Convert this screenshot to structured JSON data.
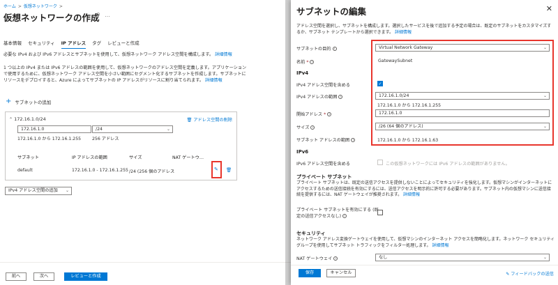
{
  "breadcrumb": {
    "home": "ホーム",
    "vnet": "仮想ネットワーク"
  },
  "page_title": "仮想ネットワークの作成",
  "tabs": [
    "基本情報",
    "セキュリティ",
    "IP アドレス",
    "タグ",
    "レビューと作成"
  ],
  "intro": {
    "line1": "必要な IPv4 および IPv6 アドレスとサブネットを使用して、仮想ネットワーク アドレス空間を構成します。",
    "link1": "詳細情報",
    "para2_1": "1 つ以上の IPv4 または IPv6 アドレスの範囲を使用して、仮想ネットワークのアドレス空間を定義します。アプリケーション",
    "para2_2": "で使用するために、仮想ネットワーク アドレス空間を小さい範囲にセグメント化するサブネットを作成します。サブネットに",
    "para2_3": "リソースをデプロイすると、Azure によってサブネットの IP アドレスがリソースに割り当てられます。",
    "link2": "詳細情報"
  },
  "add_subnet_label": "サブネットの追加",
  "address_space": {
    "header": "172.16.1.0/24",
    "delete_link": "アドレス空間の削除",
    "address_value": "172.16.1.0",
    "range_text": "172.16.1.0 から 172.16.1.255",
    "prefix_value": "/24",
    "count_text": "256 アドレス",
    "table_headers": [
      "サブネット",
      "IP アドレスの範囲",
      "サイズ",
      "NAT ゲートウ…"
    ],
    "rows": [
      {
        "name": "default",
        "range": "172.16.1.0 - 172.16.1.255",
        "size": "/24 (256 個のアドレス",
        "nat": "-"
      }
    ]
  },
  "add_ipv4_label": "IPv4 アドレス空間の追加",
  "footer_left": {
    "prev": "前へ",
    "next": "次へ",
    "review": "レビューと作成"
  },
  "panel": {
    "title": "サブネットの編集",
    "description_1": "アドレス空間を選択し、サブネットを構成します。選択したサービスを後で追加する予定の場合は、既定のサブネットをカスタマイズす",
    "description_2": "るか、サブネット テンプレートから選択できます。",
    "description_link": "詳細情報",
    "purpose_label": "サブネットの目的",
    "purpose_value": "Virtual Network Gateway",
    "name_label": "名前",
    "name_value": "GatewaySubnet",
    "ipv4_section": "IPv4",
    "include_ipv4_label": "IPv4 アドレス空間を含める",
    "ipv4_range_label": "IPv4 アドレスの範囲",
    "ipv4_range_value": "172.16.1.0/24",
    "ipv4_range_hint": "172.16.1.0 から 172.16.1.255",
    "start_label": "開始アドレス",
    "start_value": "172.16.1.0",
    "size_label": "サイズ",
    "size_value": "/26 (64 個のアドレス)",
    "subnet_range_label": "サブネット アドレスの範囲",
    "subnet_range_value": "172.16.1.0 から 172.16.1.63",
    "ipv6_section": "IPv6",
    "include_ipv6_label": "IPv6 アドレス空間を含める",
    "ipv6_disabled_text": "この仮想ネットワークには IPv6 アドレスの範囲がありません。",
    "private_section": "プライベート サブネット",
    "private_desc_1": "プライベート サブネットは、既定の送信アクセスを提供しないことによってセキュリティを強化します。仮想マシンがインターネットに",
    "private_desc_2": "アクセスするための送信接続を有効にするには、送信アクセスを明示的に許可する必要があります。サブネット内の仮想マシンに送信接",
    "private_desc_3": "続を提供するには、NAT ゲートウェイが推奨されます。",
    "private_link": "詳細情報",
    "private_check_label_1": "プライベート サブネットを有効にする (既",
    "private_check_label_2": "定の送信アクセスなし)",
    "security_section": "セキュリティ",
    "security_desc_1": "ネットワーク アドレス変換ゲートウェイを使用して、仮想マシンのインターネット アクセスを簡略化します。ネットワーク セキュリティ",
    "security_desc_2": "グループを使用してサブネット トラフィックをフィルター処理します。",
    "security_link": "詳細情報",
    "nat_label": "NAT ゲートウェイ",
    "nat_value": "なし",
    "save": "保存",
    "cancel": "キャンセル",
    "feedback": "フィードバックの送信"
  },
  "colors": {
    "accent": "#0078d4",
    "highlight": "#e8352c"
  }
}
